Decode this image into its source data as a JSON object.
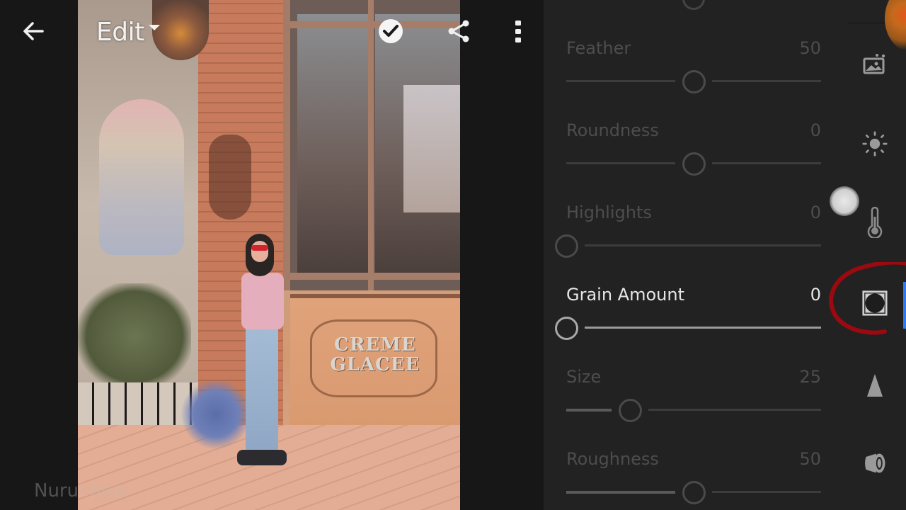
{
  "toolbar": {
    "back_icon": "arrow-left-icon",
    "mode_label": "Edit",
    "mode_dropdown_icon": "caret-down-icon",
    "done_icon": "check-circle-icon",
    "share_icon": "share-icon",
    "more_icon": "more-vertical-icon"
  },
  "photo": {
    "sign_line1": "CREME",
    "sign_line2": "GLACEE"
  },
  "watermark": "Nurul hep",
  "panel": {
    "sliders": [
      {
        "label": "Feather",
        "value": "50",
        "fraction": 0.5,
        "active": false,
        "fill": false
      },
      {
        "label": "Roundness",
        "value": "0",
        "fraction": 0.5,
        "active": false,
        "fill": false
      },
      {
        "label": "Highlights",
        "value": "0",
        "fraction": 0.0,
        "active": false,
        "fill": false
      },
      {
        "label": "Grain Amount",
        "value": "0",
        "fraction": 0.0,
        "active": true,
        "fill": false
      },
      {
        "label": "Size",
        "value": "25",
        "fraction": 0.25,
        "active": false,
        "fill": true
      },
      {
        "label": "Roughness",
        "value": "50",
        "fraction": 0.5,
        "active": false,
        "fill": true
      }
    ]
  },
  "rail": {
    "items": [
      {
        "name": "auto-enhance",
        "icon": "image-sparkle-icon"
      },
      {
        "name": "light",
        "icon": "sun-icon"
      },
      {
        "name": "color",
        "icon": "thermometer-icon"
      },
      {
        "name": "effects",
        "icon": "vignette-square-icon",
        "active": true
      },
      {
        "name": "detail",
        "icon": "triangle-icon"
      },
      {
        "name": "optics",
        "icon": "lens-icon"
      }
    ],
    "accent_color": "#2d7bf2",
    "annotation_color": "#9b0a10"
  }
}
